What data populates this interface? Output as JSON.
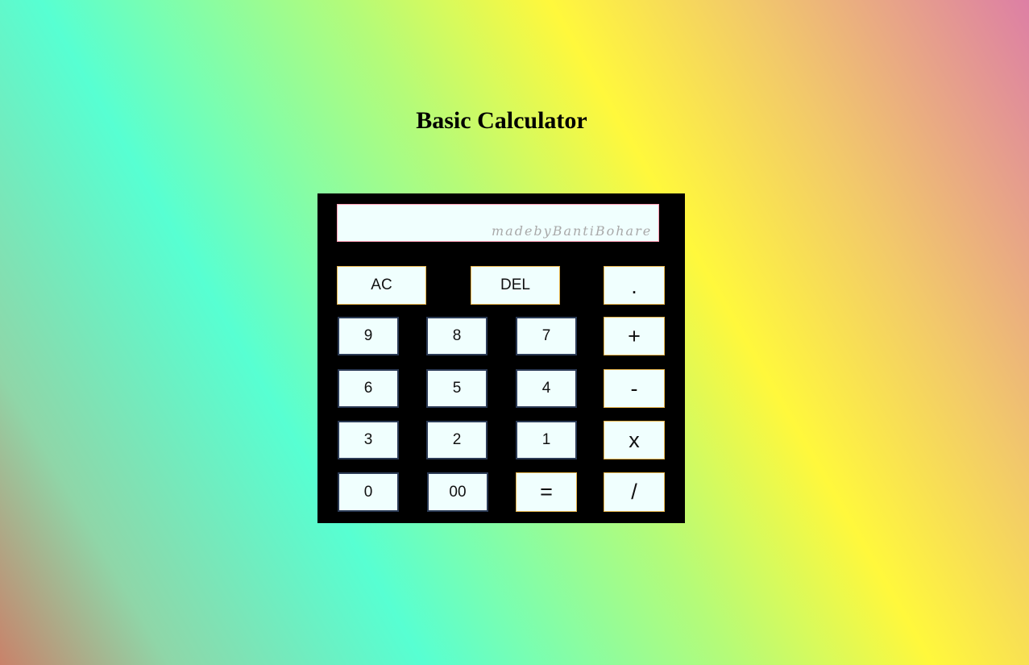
{
  "page": {
    "title": "Basic Calculator"
  },
  "display": {
    "value": "",
    "watermark": "madebyBantiBohare"
  },
  "buttons": {
    "ac": "AC",
    "del": "DEL",
    "dot": ".",
    "nine": "9",
    "eight": "8",
    "seven": "7",
    "plus": "+",
    "six": "6",
    "five": "5",
    "four": "4",
    "minus": "-",
    "three": "3",
    "two": "2",
    "one": "1",
    "multiply": "x",
    "zero": "0",
    "double_zero": "00",
    "equals": "=",
    "divide": "/"
  },
  "colors": {
    "calculator_body": "#000000",
    "button_background": "#f0fffe",
    "number_border": "#2b3a55",
    "operator_border": "#e6b44a",
    "display_border": "#ff9eb4"
  }
}
